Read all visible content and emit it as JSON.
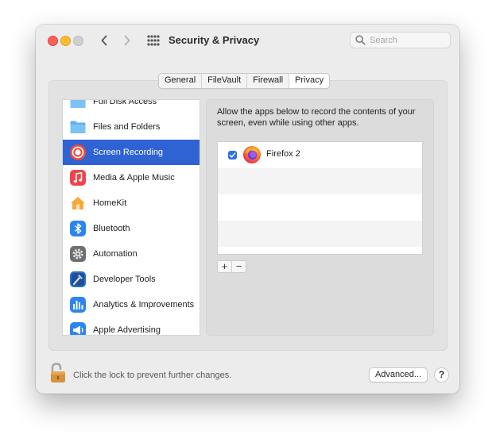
{
  "window": {
    "title": "Security & Privacy",
    "search_placeholder": "Search"
  },
  "tabs": [
    {
      "label": "General",
      "active": false
    },
    {
      "label": "FileVault",
      "active": false
    },
    {
      "label": "Firewall",
      "active": false
    },
    {
      "label": "Privacy",
      "active": true
    }
  ],
  "sidebar": {
    "items": [
      {
        "label": "Full Disk Access",
        "icon": "folder-icon",
        "selected": false
      },
      {
        "label": "Files and Folders",
        "icon": "folder-icon",
        "selected": false
      },
      {
        "label": "Screen Recording",
        "icon": "screen-recording-icon",
        "selected": true
      },
      {
        "label": "Media & Apple Music",
        "icon": "music-note-icon",
        "selected": false
      },
      {
        "label": "HomeKit",
        "icon": "home-icon",
        "selected": false
      },
      {
        "label": "Bluetooth",
        "icon": "bluetooth-icon",
        "selected": false
      },
      {
        "label": "Automation",
        "icon": "gear-icon",
        "selected": false
      },
      {
        "label": "Developer Tools",
        "icon": "hammer-icon",
        "selected": false
      },
      {
        "label": "Analytics & Improvements",
        "icon": "bar-chart-icon",
        "selected": false
      },
      {
        "label": "Apple Advertising",
        "icon": "megaphone-icon",
        "selected": false
      }
    ]
  },
  "content": {
    "description": "Allow the apps below to record the contents of your screen, even while using other apps.",
    "apps": [
      {
        "name": "Firefox 2",
        "checked": true,
        "icon": "firefox-icon"
      }
    ],
    "add_label": "+",
    "remove_label": "−"
  },
  "footer": {
    "lock_text": "Click the lock to prevent further changes.",
    "advanced_label": "Advanced...",
    "help_label": "?"
  },
  "colors": {
    "accent": "#2f63d4",
    "checkbox": "#2f6ee6",
    "window_bg": "#ececec"
  }
}
